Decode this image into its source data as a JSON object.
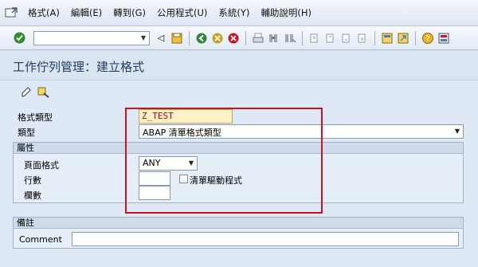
{
  "menu": {
    "items": [
      "格式(A)",
      "編輯(E)",
      "轉到(G)",
      "公用程式(U)",
      "系統(Y)",
      "輔助說明(H)"
    ]
  },
  "toolbar": {
    "command_field_value": "",
    "icons": [
      "enter-icon",
      "back-icon",
      "save-icon",
      "back-nav-icon",
      "exit-icon",
      "cancel-icon",
      "print-icon",
      "find-icon",
      "find-next-icon",
      "first-page-icon",
      "prev-page-icon",
      "next-page-icon",
      "last-page-icon",
      "create-session-icon",
      "shortcut-icon",
      "help-icon",
      "layout-icon"
    ]
  },
  "header": {
    "title": "工作佇列管理：建立格式"
  },
  "form": {
    "format_type_label": "格式類型",
    "format_type_value": "Z_TEST",
    "type_label": "類型",
    "type_value": "ABAP 清單格式類型",
    "attributes_group": {
      "title": "屬性",
      "page_format_label": "頁面格式",
      "page_format_value": "ANY",
      "lines_label": "行數",
      "lines_value": "",
      "list_driver_label": "清單驅動程式",
      "list_driver_checked": false,
      "columns_label": "欄數",
      "columns_value": ""
    },
    "remarks_group": {
      "title": "備註",
      "comment_label": "Comment",
      "comment_value": ""
    }
  },
  "colors": {
    "highlight_box": "#c8141e",
    "input_highlight": "#fdf1c7",
    "title_color": "#1f3a5f"
  }
}
